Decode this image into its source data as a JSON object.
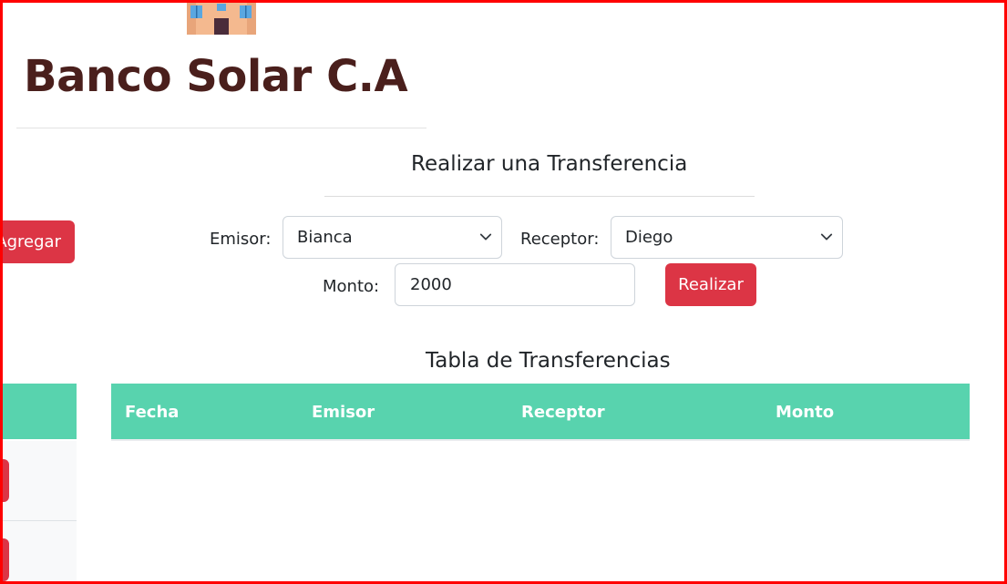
{
  "header": {
    "brand_title": "Banco Solar C.A"
  },
  "left_panel": {
    "add_button_label": "Agregar"
  },
  "transfer_form": {
    "title": "Realizar una Transferencia",
    "sender_label": "Emisor:",
    "sender_value": "Bianca",
    "receiver_label": "Receptor:",
    "receiver_value": "Diego",
    "amount_label": "Monto:",
    "amount_value": "2000",
    "submit_label": "Realizar"
  },
  "transfers_table": {
    "title": "Tabla de Transferencias",
    "columns": [
      "Fecha",
      "Emisor",
      "Receptor",
      "Monto"
    ],
    "rows": []
  },
  "colors": {
    "brand_text": "#4a1f1c",
    "danger": "#dc3545",
    "table_header": "#58d3ae",
    "frame_border": "#ff0000"
  },
  "icons": {
    "logo": "building-icon",
    "select_arrow": "chevron-down-icon"
  }
}
